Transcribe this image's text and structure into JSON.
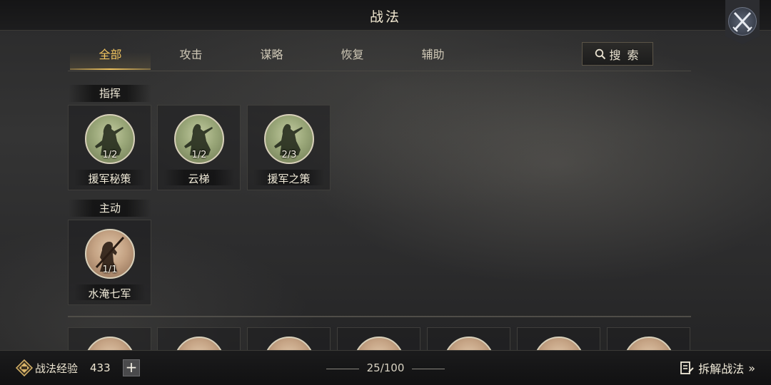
{
  "header": {
    "title": "战法",
    "close_icon": "crossed-swords-close-icon"
  },
  "tabs": [
    {
      "label": "全部",
      "active": true
    },
    {
      "label": "攻击",
      "active": false
    },
    {
      "label": "谋略",
      "active": false
    },
    {
      "label": "恢复",
      "active": false
    },
    {
      "label": "辅助",
      "active": false
    }
  ],
  "search": {
    "label": "搜 索",
    "icon": "search-icon"
  },
  "sections": [
    {
      "label": "指挥",
      "cards": [
        {
          "name": "援军秘策",
          "count": "1/2",
          "medal": "green"
        },
        {
          "name": "云梯",
          "count": "1/2",
          "medal": "green"
        },
        {
          "name": "援军之策",
          "count": "2/3",
          "medal": "green"
        }
      ]
    },
    {
      "label": "主动",
      "cards": [
        {
          "name": "水淹七军",
          "count": "1/1",
          "medal": "tan"
        }
      ]
    }
  ],
  "footer": {
    "exp_label": "战法经验",
    "exp_value": "433",
    "plus_label": "+",
    "progress": "25/100",
    "dismantle_label": "拆解战法",
    "dismantle_arrow": "»"
  },
  "colors": {
    "accent": "#f2c55f",
    "text": "#e9e2d0",
    "medal_green": "#9aa779",
    "medal_tan": "#c4a283"
  }
}
